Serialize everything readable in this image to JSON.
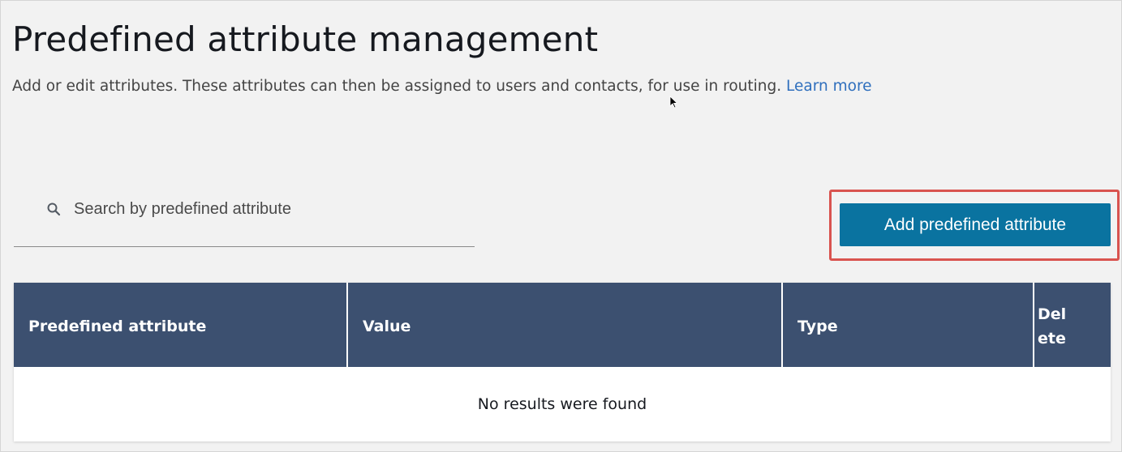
{
  "header": {
    "title": "Predefined attribute management",
    "description": "Add or edit attributes. These attributes can then be assigned to users and contacts, for use in routing.",
    "learn_more": "Learn more"
  },
  "search": {
    "placeholder": "Search by predefined attribute",
    "value": "",
    "icon": "search-icon"
  },
  "actions": {
    "add_button_label": "Add predefined attribute",
    "highlight_color": "#d9534f",
    "button_color": "#0a73a0"
  },
  "table": {
    "header_color": "#3c5070",
    "columns": [
      {
        "label": "Predefined attribute"
      },
      {
        "label": "Value"
      },
      {
        "label": "Type"
      },
      {
        "label": "Delete"
      }
    ],
    "rows": [],
    "empty_message": "No results were found"
  }
}
